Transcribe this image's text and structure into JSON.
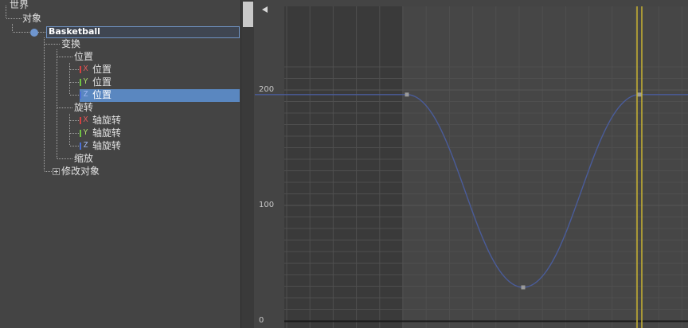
{
  "tree": {
    "world": "世界",
    "objects": "对象",
    "object_name": "Basketball",
    "transform": "变换",
    "position": "位置",
    "x_position": {
      "axis": "X",
      "label": "位置"
    },
    "y_position": {
      "axis": "Y",
      "label": "位置"
    },
    "z_position": {
      "axis": "Z",
      "label": "位置"
    },
    "rotation": "旋转",
    "x_rotation": {
      "axis": "X",
      "label": "轴旋转"
    },
    "y_rotation": {
      "axis": "Y",
      "label": "轴旋转"
    },
    "z_rotation": {
      "axis": "Z",
      "label": "轴旋转"
    },
    "scale": "缩放",
    "modified_object": "修改对象"
  },
  "colors": {
    "selection": "#5a87c0",
    "curve": "#4a5c9a",
    "time_slider": "#c8b432",
    "axis_x": "#d44141",
    "axis_y": "#6ec441",
    "axis_z": "#4a6fd8"
  },
  "curve_editor": {
    "y_ticks": [
      {
        "label": "200",
        "value": 200
      },
      {
        "label": "100",
        "value": 100
      },
      {
        "label": "0",
        "value": 0
      }
    ],
    "keys": [
      {
        "frame": 0,
        "value": 196
      },
      {
        "frame": 60,
        "value": 29
      },
      {
        "frame": 120,
        "value": 196
      }
    ],
    "active_range_start_frame": 0,
    "current_frame": 120
  }
}
